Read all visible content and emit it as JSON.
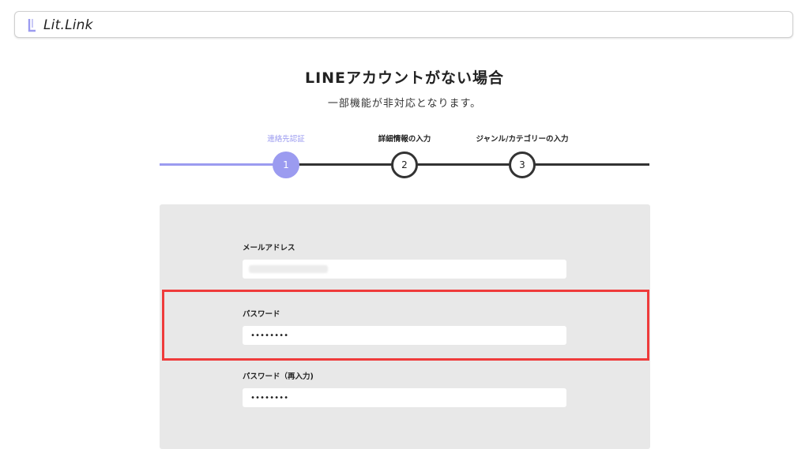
{
  "header": {
    "logo_text": "Lit.Link",
    "logo_icon": "bracket-logo-icon",
    "accent": "#9b9bf0"
  },
  "page": {
    "title": "LINEアカウントがない場合",
    "subtitle": "一部機能が非対応となります。"
  },
  "stepper": {
    "active_color": "#9b9bf0",
    "steps": [
      {
        "number": "1",
        "label": "連絡先認証",
        "state": "active"
      },
      {
        "number": "2",
        "label": "詳細情報の入力",
        "state": "pending"
      },
      {
        "number": "3",
        "label": "ジャンル/カテゴリーの入力",
        "state": "pending"
      }
    ]
  },
  "form": {
    "email": {
      "label": "メールアドレス",
      "value": ""
    },
    "password": {
      "label": "パスワード",
      "value": "••••••••"
    },
    "password_confirm": {
      "label": "パスワード（再入力)",
      "value": "••••••••"
    }
  },
  "highlight": {
    "color": "#ef3b3b"
  }
}
